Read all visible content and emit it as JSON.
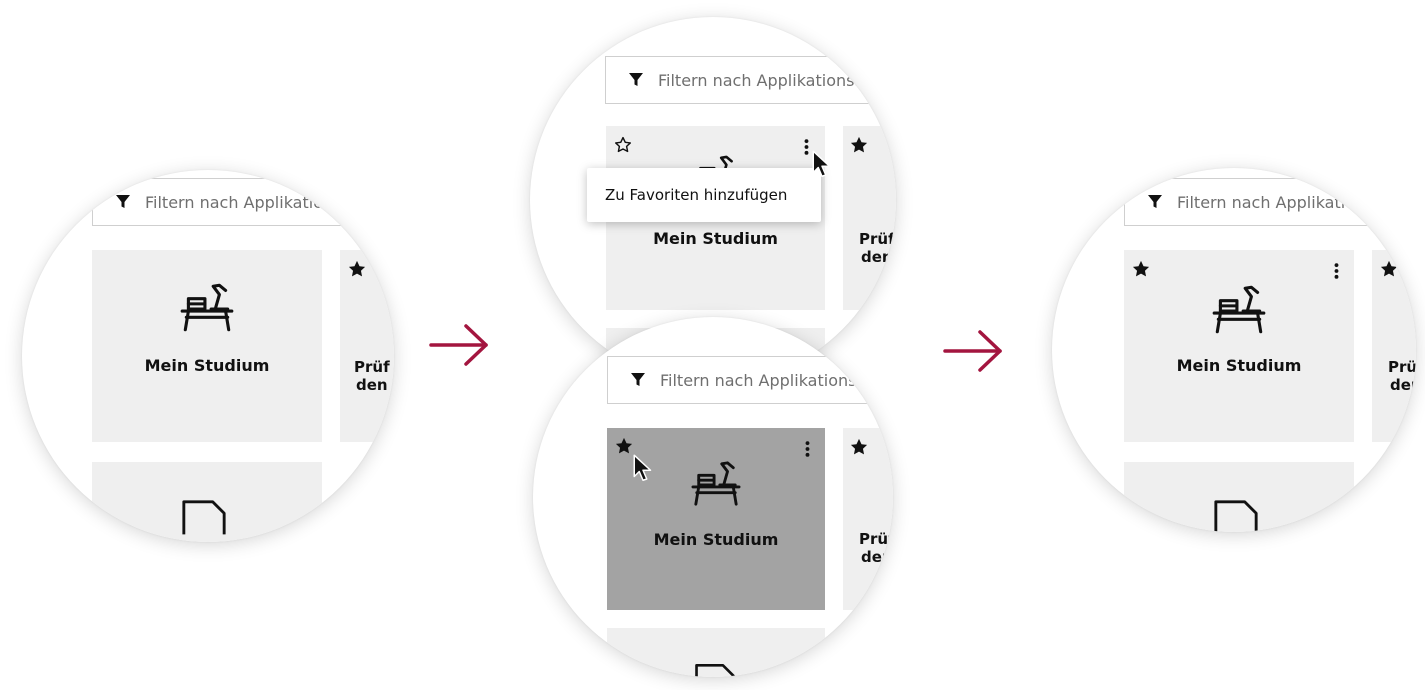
{
  "filter": {
    "placeholder": "Filtern nach Applikationsname"
  },
  "tiles": {
    "main": {
      "label": "Mein Studium"
    },
    "side": {
      "line1": "Prüf",
      "line2": "den"
    }
  },
  "menu": {
    "add_favorite": "Zu Favoriten hinzufügen"
  },
  "colors": {
    "arrow": "#a3153f",
    "tile_bg": "#efefef",
    "tile_hover_bg": "#a3a3a3",
    "filter_border": "#cfcfcf"
  },
  "icons": {
    "filter": "filter-icon",
    "star_empty": "star-outline-icon",
    "star_filled": "star-filled-icon",
    "menu": "kebab-menu-icon",
    "cursor": "mouse-cursor-icon",
    "desk": "desk-study-icon",
    "document": "document-icon",
    "arrow": "arrow-right-icon"
  }
}
